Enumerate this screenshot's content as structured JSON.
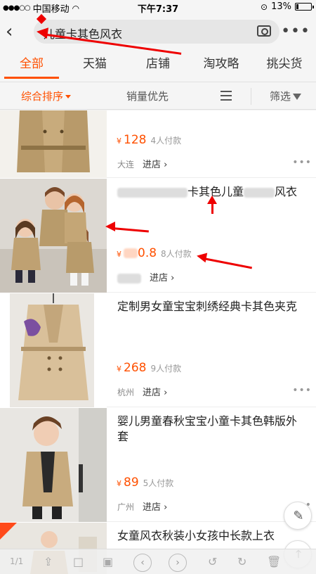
{
  "status": {
    "carrier": "中国移动",
    "time": "下午7:37",
    "battery": "13%"
  },
  "search": {
    "query": "儿童卡其色风衣"
  },
  "tabs": [
    "全部",
    "天猫",
    "店铺",
    "淘攻略",
    "挑尖货"
  ],
  "sort": {
    "primary": "综合排序",
    "sales": "销量优先",
    "filter": "筛选"
  },
  "items": [
    {
      "title": "",
      "price": "128",
      "paid": "4人付款",
      "city": "大连",
      "shop": "进店 ›"
    },
    {
      "title_visible": "卡其色儿童",
      "title_end": "风衣",
      "price": "0.8",
      "paid": "8人付款",
      "city": "",
      "shop": "进店 ›"
    },
    {
      "title": "定制男女童宝宝刺绣经典卡其色夹克",
      "price": "268",
      "paid": "9人付款",
      "city": "杭州",
      "shop": "进店 ›"
    },
    {
      "title": "婴儿男童春秋宝宝小童卡其色韩版外套",
      "price": "89",
      "paid": "5人付款",
      "city": "广州",
      "shop": "进店 ›"
    },
    {
      "title": "女童风衣秋装小女孩中长款上衣",
      "price": "",
      "paid": "",
      "city": "",
      "shop": ""
    }
  ],
  "currency": "¥",
  "bottom": {
    "page": "1/1"
  },
  "colors": {
    "accent": "#ff5000",
    "annotation": "#e00000"
  }
}
